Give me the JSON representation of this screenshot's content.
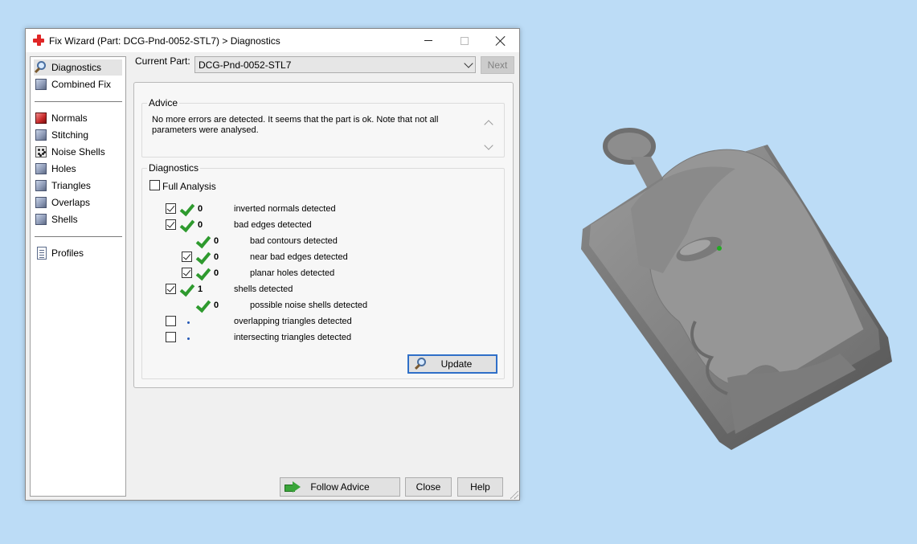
{
  "window": {
    "title": "Fix Wizard (Part: DCG-Pnd-0052-STL7) > Diagnostics"
  },
  "sidebar": {
    "items": [
      {
        "label": "Diagnostics",
        "icon": "magnifier-icon",
        "selected": true
      },
      {
        "label": "Combined Fix",
        "icon": "cube-icon"
      },
      {
        "label": "Normals",
        "icon": "normals-cube-icon"
      },
      {
        "label": "Stitching",
        "icon": "stitching-cube-icon"
      },
      {
        "label": "Noise Shells",
        "icon": "noise-shells-icon"
      },
      {
        "label": "Holes",
        "icon": "holes-cube-icon"
      },
      {
        "label": "Triangles",
        "icon": "triangles-cube-icon"
      },
      {
        "label": "Overlaps",
        "icon": "overlaps-cube-icon"
      },
      {
        "label": "Shells",
        "icon": "shells-cube-icon"
      },
      {
        "label": "Profiles",
        "icon": "document-icon"
      }
    ]
  },
  "header": {
    "current_part_label": "Current Part:",
    "current_part_value": "DCG-Pnd-0052-STL7",
    "next_label": "Next"
  },
  "advice": {
    "title": "Advice",
    "text": "No more errors are detected. It seems that the part is ok. Note that not all parameters were analysed."
  },
  "diagnostics": {
    "title": "Diagnostics",
    "full_analysis_label": "Full Analysis",
    "rows": [
      {
        "count": "0",
        "label": "inverted normals detected",
        "checked": true,
        "status": "ok"
      },
      {
        "count": "0",
        "label": "bad edges detected",
        "checked": true,
        "status": "ok"
      },
      {
        "count": "0",
        "label": "bad contours detected",
        "checked": null,
        "status": "ok"
      },
      {
        "count": "0",
        "label": "near bad edges detected",
        "checked": true,
        "status": "ok"
      },
      {
        "count": "0",
        "label": "planar holes detected",
        "checked": true,
        "status": "ok"
      },
      {
        "count": "1",
        "label": "shells detected",
        "checked": true,
        "status": "ok"
      },
      {
        "count": "0",
        "label": "possible noise shells detected",
        "checked": null,
        "status": "ok"
      },
      {
        "count": "",
        "label": "overlapping triangles detected",
        "checked": false,
        "status": "none"
      },
      {
        "count": "",
        "label": "intersecting triangles detected",
        "checked": false,
        "status": "none"
      }
    ],
    "update_label": "Update"
  },
  "footer": {
    "follow_advice_label": "Follow Advice",
    "close_label": "Close",
    "help_label": "Help"
  },
  "colors": {
    "desktop": "#bcdcf6",
    "ok_check": "#2e9a2e",
    "focus_border": "#2f6fc8"
  }
}
